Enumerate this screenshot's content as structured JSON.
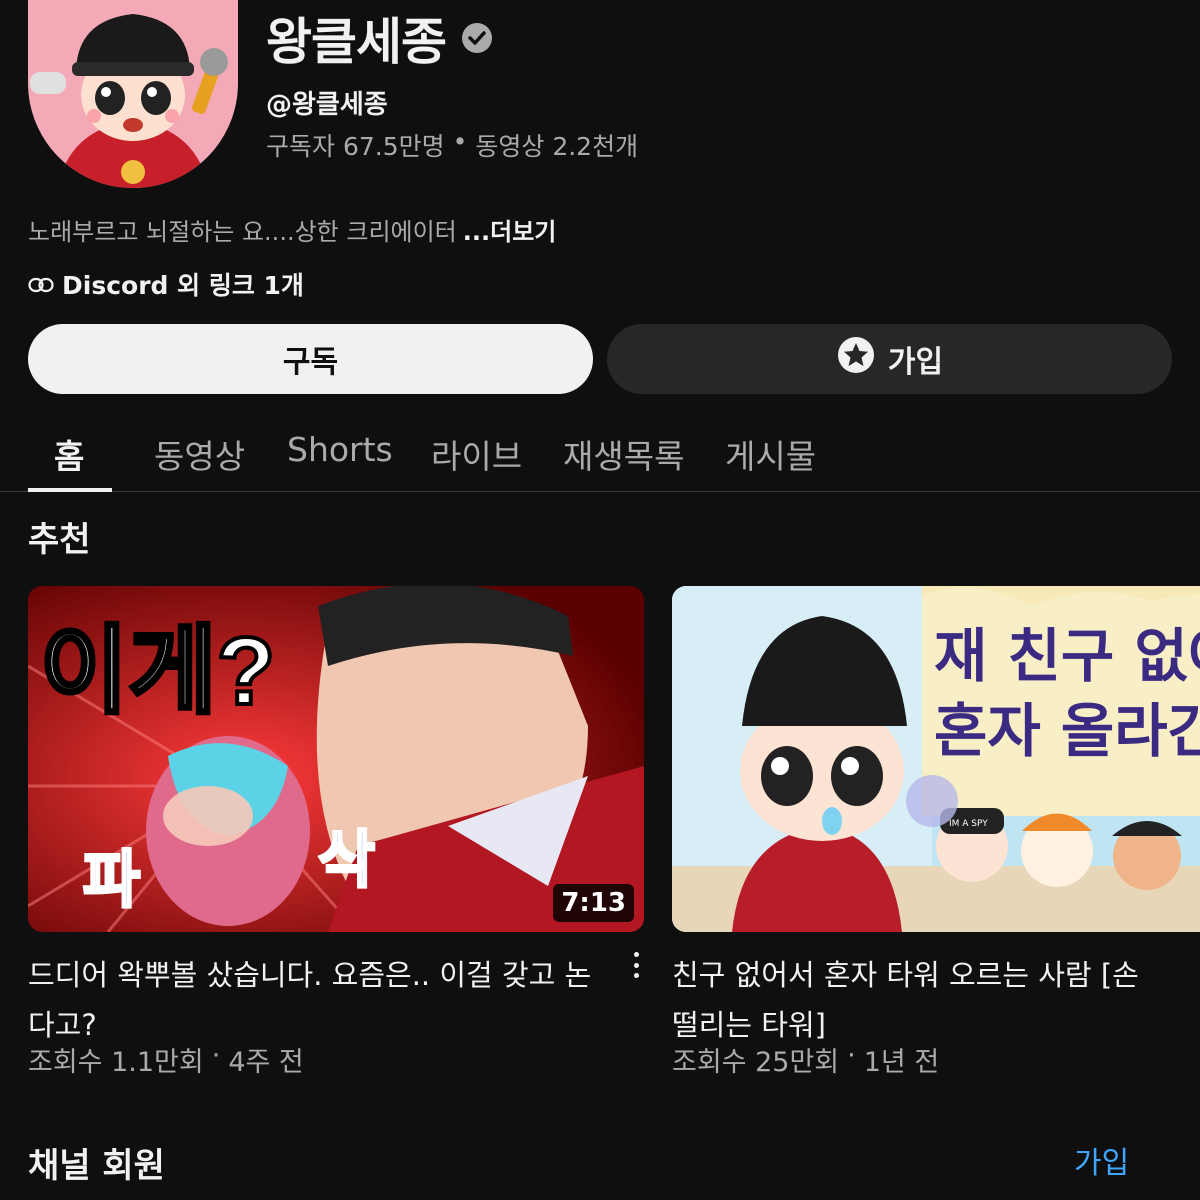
{
  "channel": {
    "name": "왕클세종",
    "handle": "@왕클세종",
    "subscribers": "구독자 67.5만명",
    "separator": "•",
    "videos": "동영상 2.2천개",
    "description": "노래부르고 뇌절하는 요....상한 크리에이터",
    "more_label": "...더보기",
    "links_label": "Discord 외 링크 1개"
  },
  "buttons": {
    "subscribe": "구독",
    "join": "가입"
  },
  "tabs": [
    "홈",
    "동영상",
    "Shorts",
    "라이브",
    "재생목록",
    "게시물"
  ],
  "active_tab": "홈",
  "section_title": "추천",
  "videos": [
    {
      "thumb_text_top": "이게?",
      "thumb_text_bottom_left": "파",
      "thumb_text_bottom_right": "삭",
      "duration": "7:13",
      "title": "드디어 왁뿌볼 샀습니다. 요즘은.. 이걸 갖고 논다고?",
      "views": "조회수 1.1만회",
      "dot": "·",
      "age": "4주 전"
    },
    {
      "thumb_text_line1": "재 친구 없어",
      "thumb_text_line2": "혼자 올라간",
      "thumb_badge": "IM A SPY",
      "title": "친구 없어서 혼자 타워 오르는 사람 [손 떨리는 타워]",
      "views": "조회수 25만회",
      "dot": "·",
      "age": "1년 전"
    }
  ],
  "members_section": {
    "title": "채널 회원",
    "join_label": "가입"
  },
  "colors": {
    "background": "#0f0f0f",
    "subscribe_bg": "#f1f1f1",
    "join_bg": "#272727",
    "link_blue": "#3ea6ff",
    "secondary_text": "#aaaaaa"
  },
  "icons": {
    "verified": "check-circle-icon",
    "link": "link-icon",
    "join": "star-badge-icon",
    "menu": "more-vertical-icon"
  }
}
